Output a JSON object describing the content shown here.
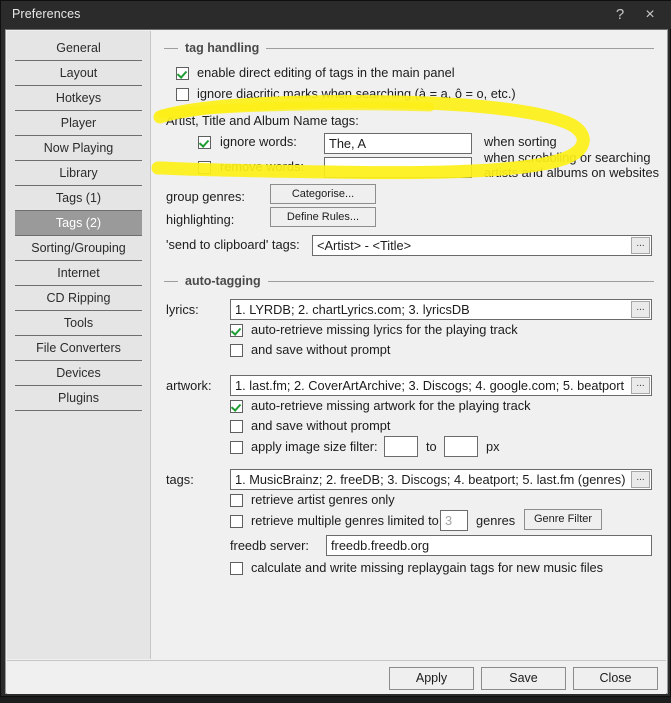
{
  "window": {
    "title": "Preferences",
    "help_icon": "?",
    "close_icon": "×"
  },
  "sidebar": {
    "items": [
      {
        "label": "General",
        "selected": false
      },
      {
        "label": "Layout",
        "selected": false
      },
      {
        "label": "Hotkeys",
        "selected": false
      },
      {
        "label": "Player",
        "selected": false
      },
      {
        "label": "Now Playing",
        "selected": false
      },
      {
        "label": "Library",
        "selected": false
      },
      {
        "label": "Tags (1)",
        "selected": false
      },
      {
        "label": "Tags (2)",
        "selected": true
      },
      {
        "label": "Sorting/Grouping",
        "selected": false
      },
      {
        "label": "Internet",
        "selected": false
      },
      {
        "label": "CD Ripping",
        "selected": false
      },
      {
        "label": "Tools",
        "selected": false
      },
      {
        "label": "File Converters",
        "selected": false
      },
      {
        "label": "Devices",
        "selected": false
      },
      {
        "label": "Plugins",
        "selected": false
      }
    ]
  },
  "tag_handling": {
    "group_title": "tag handling",
    "enable_direct_editing": {
      "label": "enable direct editing of tags in the main panel",
      "checked": true
    },
    "ignore_diacritic": {
      "label": "ignore diacritic marks when searching (à = a, ô = o, etc.)",
      "checked": false
    },
    "name_tags_label": "Artist, Title and Album Name tags:",
    "ignore_words": {
      "label": "ignore words:",
      "checked": true,
      "value": "The, A",
      "suffix": "when sorting"
    },
    "remove_words": {
      "label": "remove words:",
      "checked": false,
      "value": "",
      "suffix": "when scrobbling or searching artists and albums on websites"
    },
    "group_genres": {
      "label": "group genres:",
      "button": "Categorise..."
    },
    "highlighting": {
      "label": "highlighting:",
      "button": "Define Rules..."
    },
    "send_to_clipboard": {
      "label": "'send to clipboard' tags:",
      "value": "<Artist> - <Title>",
      "browse_icon": "..."
    }
  },
  "auto_tagging": {
    "group_title": "auto-tagging",
    "lyrics": {
      "label": "lyrics:",
      "value": "1. LYRDB; 2. chartLyrics.com; 3. lyricsDB",
      "browse_icon": "...",
      "auto_retrieve": {
        "label": "auto-retrieve missing lyrics for the playing track",
        "checked": true
      },
      "save_without_prompt": {
        "label": "and save without prompt",
        "checked": false
      }
    },
    "artwork": {
      "label": "artwork:",
      "value": "1. last.fm; 2. CoverArtArchive; 3. Discogs; 4. google.com; 5. beatport",
      "browse_icon": "...",
      "auto_retrieve": {
        "label": "auto-retrieve missing artwork for the playing track",
        "checked": true
      },
      "save_without_prompt": {
        "label": "and save without prompt",
        "checked": false
      },
      "size_filter": {
        "label": "apply image size filter:",
        "checked": false,
        "min_value": "",
        "mid_label": "to",
        "max_value": "",
        "unit": "px"
      }
    },
    "tags": {
      "label": "tags:",
      "value": "1. MusicBrainz; 2. freeDB; 3. Discogs; 4. beatport; 5. last.fm (genres)",
      "browse_icon": "...",
      "artist_genres_only": {
        "label": "retrieve artist genres only",
        "checked": false
      },
      "multiple_genres": {
        "label": "retrieve multiple genres limited to:",
        "checked": false,
        "count": "3",
        "unit": "genres",
        "button": "Genre Filter"
      },
      "freedb_server": {
        "label": "freedb server:",
        "value": "freedb.freedb.org"
      },
      "replaygain": {
        "label": "calculate and write missing replaygain tags for new music files",
        "checked": false
      }
    }
  },
  "footer": {
    "apply": "Apply",
    "save": "Save",
    "close": "Close"
  },
  "annotation": {
    "type": "highlighter-ellipse",
    "color": "#fdf017"
  }
}
